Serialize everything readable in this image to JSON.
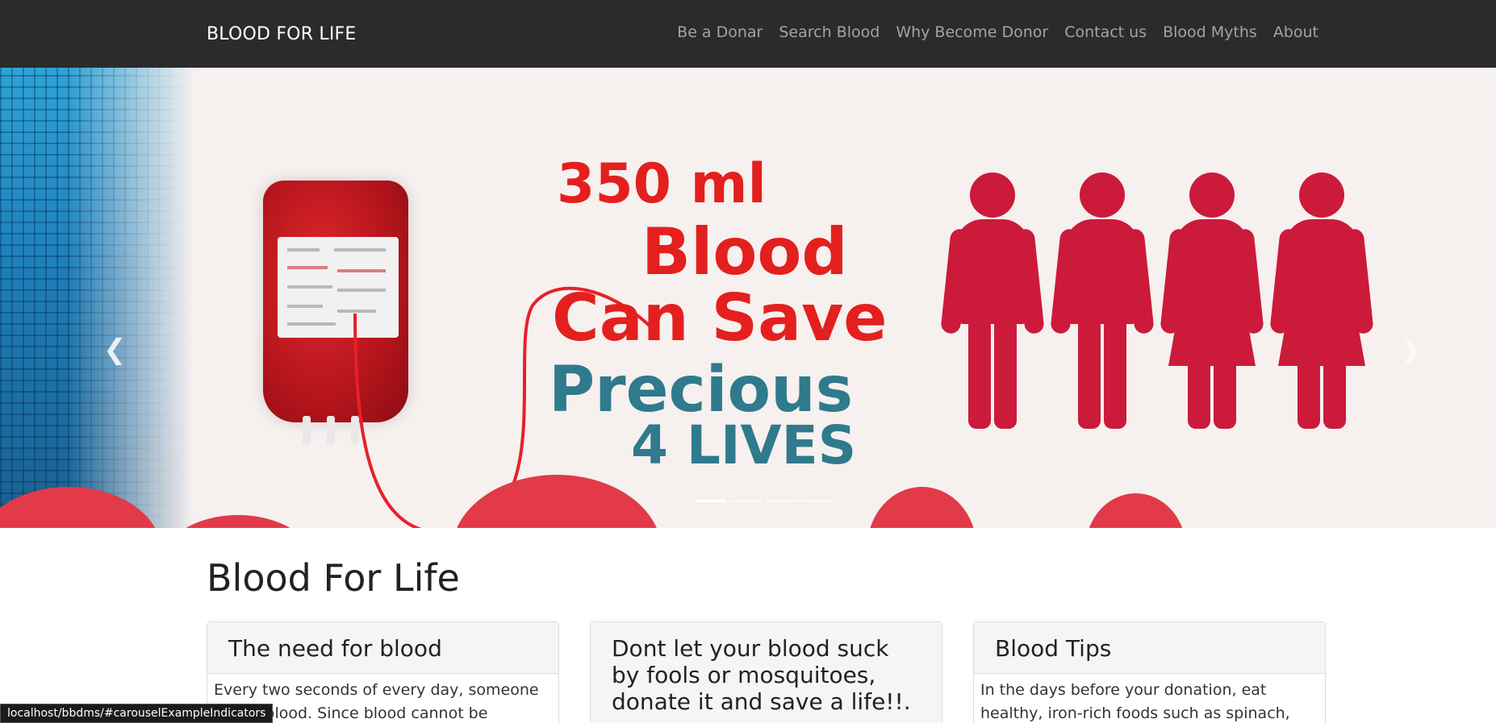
{
  "navbar": {
    "brand": "BLOOD FOR LIFE",
    "links": [
      "Be a Donar",
      "Search Blood",
      "Why Become Donor",
      "Contact us",
      "Blood Myths",
      "About"
    ]
  },
  "carousel": {
    "slide_text": {
      "line1": "350 ml",
      "line2": "Blood",
      "line3": "Can Save",
      "line4": "Precious",
      "line5": "4 LIVES"
    },
    "prev_icon": "chevron-left-icon",
    "next_icon": "chevron-right-icon",
    "indicator_count": 4,
    "active_indicator": 0,
    "colors": {
      "red_text": "#e3201e",
      "teal_text": "#2f7a8c",
      "people": "#cc1a3b"
    }
  },
  "main": {
    "heading": "Blood For Life",
    "cards": [
      {
        "title": "The need for blood",
        "body": "Every two seconds of every day, someone needs blood. Since blood cannot be manufactured"
      },
      {
        "title": "Dont let your blood suck by fools or mosquitoes, donate it and save a life!!.",
        "body": ""
      },
      {
        "title": "Blood Tips",
        "body": "In the days before your donation, eat healthy, iron-rich foods such as spinach, red meat, fish,"
      }
    ]
  },
  "statusbar": {
    "url": "localhost/bbdms/#carouselExampleIndicators"
  }
}
